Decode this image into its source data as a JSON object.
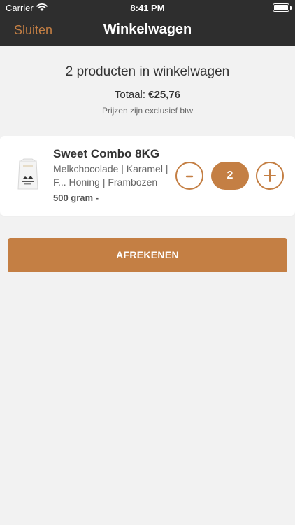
{
  "status_bar": {
    "carrier": "Carrier",
    "time": "8:41 PM"
  },
  "nav": {
    "close_label": "Sluiten",
    "title": "Winkelwagen"
  },
  "summary": {
    "count_text": "2 producten in winkelwagen",
    "total_label": "Totaal:",
    "total_amount": "€25,76",
    "vat_note": "Prijzen zijn exclusief btw"
  },
  "cart": {
    "items": [
      {
        "name": "Sweet Combo 8KG",
        "description": "Melkchocolade | Karamel | F... Honing | Frambozen",
        "weight": "500 gram -",
        "quantity": "2"
      }
    ]
  },
  "checkout": {
    "label": "AFREKENEN"
  },
  "colors": {
    "accent": "#c47f44",
    "header_bg": "#2e2e2e",
    "page_bg": "#f2f2f2"
  }
}
